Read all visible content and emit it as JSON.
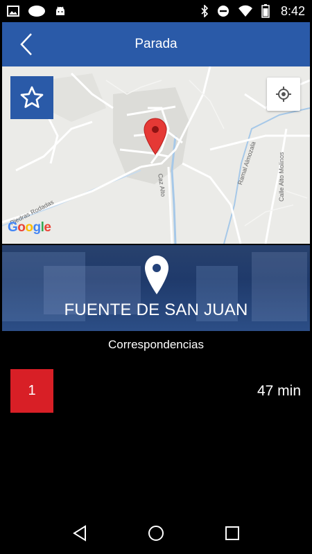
{
  "status_bar": {
    "time": "8:42",
    "left_icons": [
      "image-icon",
      "cloud-icon",
      "android-icon"
    ],
    "right_icons": [
      "bluetooth-icon",
      "do-not-disturb-icon",
      "wifi-icon",
      "battery-icon"
    ]
  },
  "app_bar": {
    "title": "Parada",
    "back_icon": "chevron-left-icon"
  },
  "map": {
    "labels": {
      "piedras_rodadas": "Piedras Rodadas",
      "caz_alto": "Caz Alto",
      "ramal_almozala": "Ramal Almozala",
      "calle_alto_molinos": "Calle Alto Molinos",
      "google": "Google"
    },
    "favorite_icon": "star-icon",
    "locate_icon": "my-location-icon",
    "marker_icon": "map-marker-icon",
    "marker_color": "#e53935"
  },
  "stop": {
    "name": "FUENTE DE SAN JUAN",
    "pin_icon": "location-pin-icon"
  },
  "correspondencias": {
    "title": "Correspondencias",
    "lines": [
      {
        "number": "1",
        "time": "47 min",
        "color": "#d81f26"
      }
    ]
  },
  "colors": {
    "primary": "#2a5aa8",
    "line_red": "#d81f26",
    "background": "#000000"
  },
  "nav_bar": {
    "back_icon": "nav-back-icon",
    "home_icon": "nav-home-icon",
    "recents_icon": "nav-recents-icon"
  }
}
